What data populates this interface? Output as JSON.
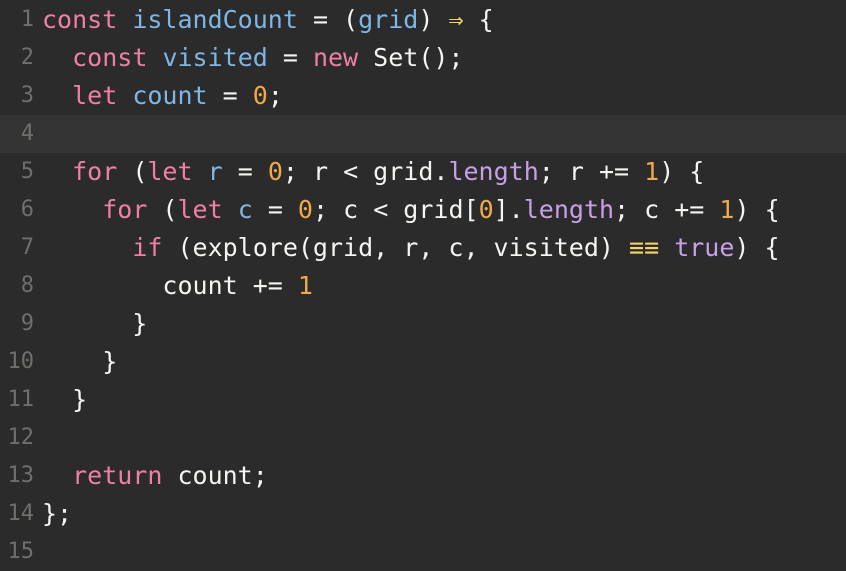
{
  "editor": {
    "lines": [
      {
        "n": "1",
        "tokens": [
          [
            "kw",
            "const"
          ],
          [
            "plain",
            " "
          ],
          [
            "def",
            "islandCount"
          ],
          [
            "plain",
            " = ("
          ],
          [
            "def",
            "grid"
          ],
          [
            "plain",
            ") "
          ],
          [
            "op",
            "⇒"
          ],
          [
            "plain",
            " {"
          ]
        ]
      },
      {
        "n": "2",
        "tokens": [
          [
            "plain",
            "  "
          ],
          [
            "kw",
            "const"
          ],
          [
            "plain",
            " "
          ],
          [
            "def",
            "visited"
          ],
          [
            "plain",
            " = "
          ],
          [
            "kw",
            "new"
          ],
          [
            "plain",
            " Set();"
          ]
        ]
      },
      {
        "n": "3",
        "tokens": [
          [
            "plain",
            "  "
          ],
          [
            "kw",
            "let"
          ],
          [
            "plain",
            " "
          ],
          [
            "def",
            "count"
          ],
          [
            "plain",
            " = "
          ],
          [
            "num",
            "0"
          ],
          [
            "plain",
            ";"
          ]
        ]
      },
      {
        "n": "4",
        "tokens": [],
        "current": true
      },
      {
        "n": "5",
        "tokens": [
          [
            "plain",
            "  "
          ],
          [
            "kw",
            "for"
          ],
          [
            "plain",
            " ("
          ],
          [
            "kw",
            "let"
          ],
          [
            "plain",
            " "
          ],
          [
            "def",
            "r"
          ],
          [
            "plain",
            " = "
          ],
          [
            "num",
            "0"
          ],
          [
            "plain",
            "; r < grid."
          ],
          [
            "prop",
            "length"
          ],
          [
            "plain",
            "; r += "
          ],
          [
            "num",
            "1"
          ],
          [
            "plain",
            ") {"
          ]
        ]
      },
      {
        "n": "6",
        "tokens": [
          [
            "plain",
            "    "
          ],
          [
            "kw",
            "for"
          ],
          [
            "plain",
            " ("
          ],
          [
            "kw",
            "let"
          ],
          [
            "plain",
            " "
          ],
          [
            "def",
            "c"
          ],
          [
            "plain",
            " = "
          ],
          [
            "num",
            "0"
          ],
          [
            "plain",
            "; c < grid["
          ],
          [
            "num",
            "0"
          ],
          [
            "plain",
            "]."
          ],
          [
            "prop",
            "length"
          ],
          [
            "plain",
            "; c += "
          ],
          [
            "num",
            "1"
          ],
          [
            "plain",
            ") {"
          ]
        ]
      },
      {
        "n": "7",
        "tokens": [
          [
            "plain",
            "      "
          ],
          [
            "kw",
            "if"
          ],
          [
            "plain",
            " (explore(grid, r, c, visited) "
          ],
          [
            "op",
            "≡≡"
          ],
          [
            "plain",
            " "
          ],
          [
            "prop",
            "true"
          ],
          [
            "plain",
            ") {"
          ]
        ]
      },
      {
        "n": "8",
        "tokens": [
          [
            "plain",
            "        count += "
          ],
          [
            "num",
            "1"
          ]
        ]
      },
      {
        "n": "9",
        "tokens": [
          [
            "plain",
            "      }"
          ]
        ]
      },
      {
        "n": "10",
        "tokens": [
          [
            "plain",
            "    }"
          ]
        ]
      },
      {
        "n": "11",
        "tokens": [
          [
            "plain",
            "  }"
          ]
        ]
      },
      {
        "n": "12",
        "tokens": []
      },
      {
        "n": "13",
        "tokens": [
          [
            "plain",
            "  "
          ],
          [
            "kw",
            "return"
          ],
          [
            "plain",
            " count;"
          ]
        ]
      },
      {
        "n": "14",
        "tokens": [
          [
            "plain",
            "};"
          ]
        ]
      },
      {
        "n": "15",
        "tokens": []
      }
    ]
  }
}
